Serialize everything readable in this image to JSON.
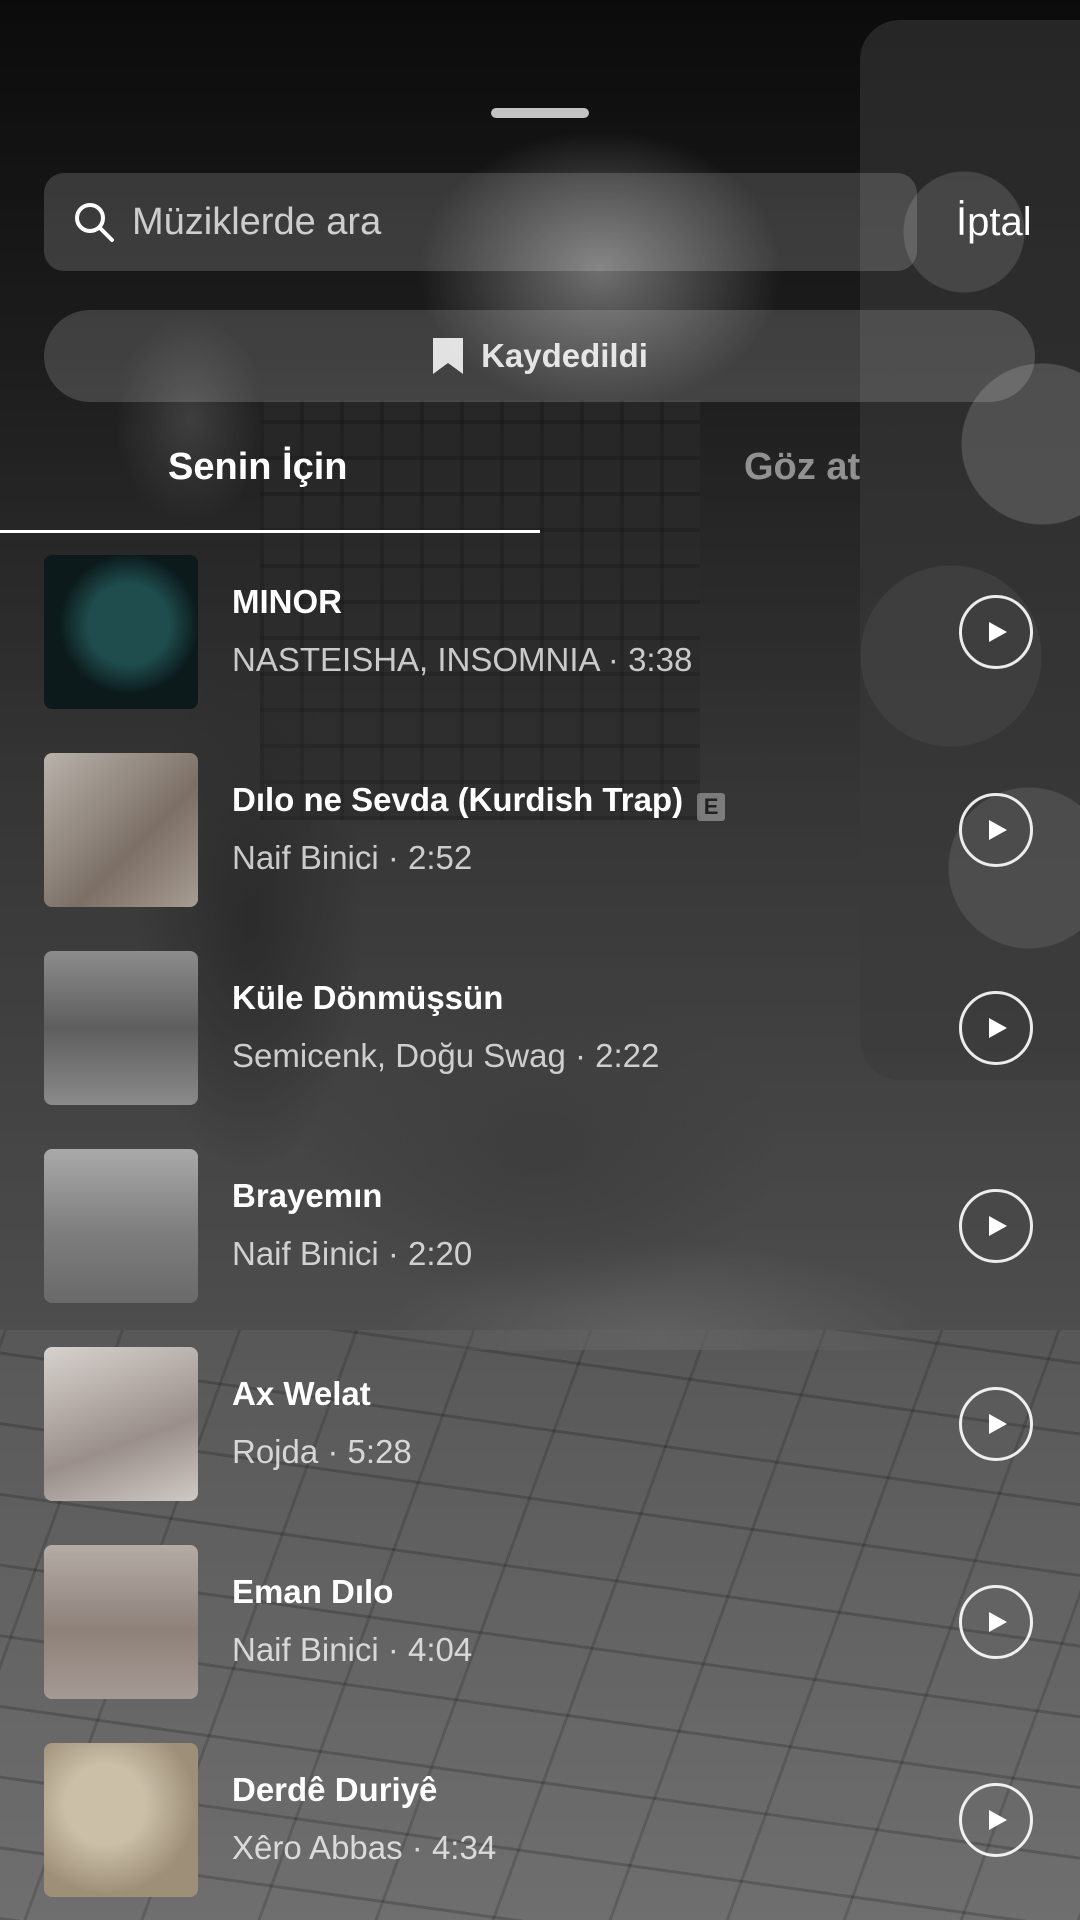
{
  "search": {
    "placeholder": "Müziklerde ara",
    "cancel_label": "İptal"
  },
  "saved": {
    "label": "Kaydedildi"
  },
  "tabs": [
    {
      "label": "Senin İçin",
      "active": true
    },
    {
      "label": "Göz at",
      "active": false
    }
  ],
  "songs": [
    {
      "title": "MINOR",
      "subtitle": "NASTEISHA, INSOMNIA · 3:38",
      "explicit": false,
      "explicit_badge": ""
    },
    {
      "title": "Dılo ne Sevda (Kurdish Trap)",
      "subtitle": "Naif Binici · 2:52",
      "explicit": true,
      "explicit_badge": "E"
    },
    {
      "title": "Küle Dönmüşsün",
      "subtitle": "Semicenk, Doğu Swag · 2:22",
      "explicit": false,
      "explicit_badge": ""
    },
    {
      "title": "Brayemın",
      "subtitle": "Naif Binici · 2:20",
      "explicit": false,
      "explicit_badge": ""
    },
    {
      "title": "Ax Welat",
      "subtitle": "Rojda · 5:28",
      "explicit": false,
      "explicit_badge": ""
    },
    {
      "title": "Eman Dılo",
      "subtitle": "Naif Binici · 4:04",
      "explicit": false,
      "explicit_badge": ""
    },
    {
      "title": "Derdê Duriyê",
      "subtitle": "Xêro Abbas · 4:34",
      "explicit": false,
      "explicit_badge": ""
    }
  ],
  "icons": {
    "search": "search-icon",
    "bookmark": "bookmark-icon",
    "play": "play-icon"
  }
}
